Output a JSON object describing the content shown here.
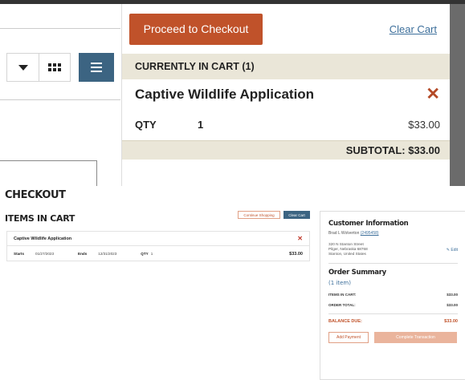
{
  "mini_cart": {
    "checkout_label": "Proceed to Checkout",
    "clear_label": "Clear Cart",
    "section_title": "CURRENTLY IN CART (1)",
    "item_name": "Captive Wildlife Application",
    "qty_label": "QTY",
    "qty_value": "1",
    "price": "$33.00",
    "subtotal": "SUBTOTAL: $33.00"
  },
  "view_toggle": {
    "icons": [
      "chevron-down-icon",
      "grid-icon",
      "list-icon"
    ],
    "active": "list"
  },
  "checkout": {
    "title": "CHECKOUT",
    "items_title": "ITEMS IN CART",
    "continue_label": "Continue Shopping",
    "clear_label": "Clear Cart",
    "item": {
      "name": "Captive Wildlife Application",
      "starts_label": "Starts",
      "starts_value": "01/27/2023",
      "ends_label": "Ends",
      "ends_value": "12/31/2023",
      "qty_label": "QTY",
      "qty_value": "1",
      "price": "$33.00"
    }
  },
  "summary": {
    "customer_title": "Customer Information",
    "customer_name": "Brad L Wolverton",
    "customer_id": "(2495458)",
    "address_line1": "320 N Stanton Street",
    "address_line2": "Pilger, Nebraska 68768",
    "address_line3": "Stanton, United States",
    "edit_label": "Edit",
    "order_title": "Order Summary",
    "order_count": "(1 item)",
    "items_label": "ITEMS IN CART:",
    "items_value": "$33.00",
    "order_total_label": "ORDER TOTAL:",
    "order_total_value": "$33.00",
    "balance_label": "BALANCE DUE:",
    "balance_value": "$33.00",
    "add_payment_label": "Add Payment",
    "complete_label": "Complete Transaction"
  },
  "colors": {
    "accent": "#c0522a",
    "link": "#3d6f9b",
    "active_view": "#3c6482",
    "section_bg": "#eae6d8"
  }
}
